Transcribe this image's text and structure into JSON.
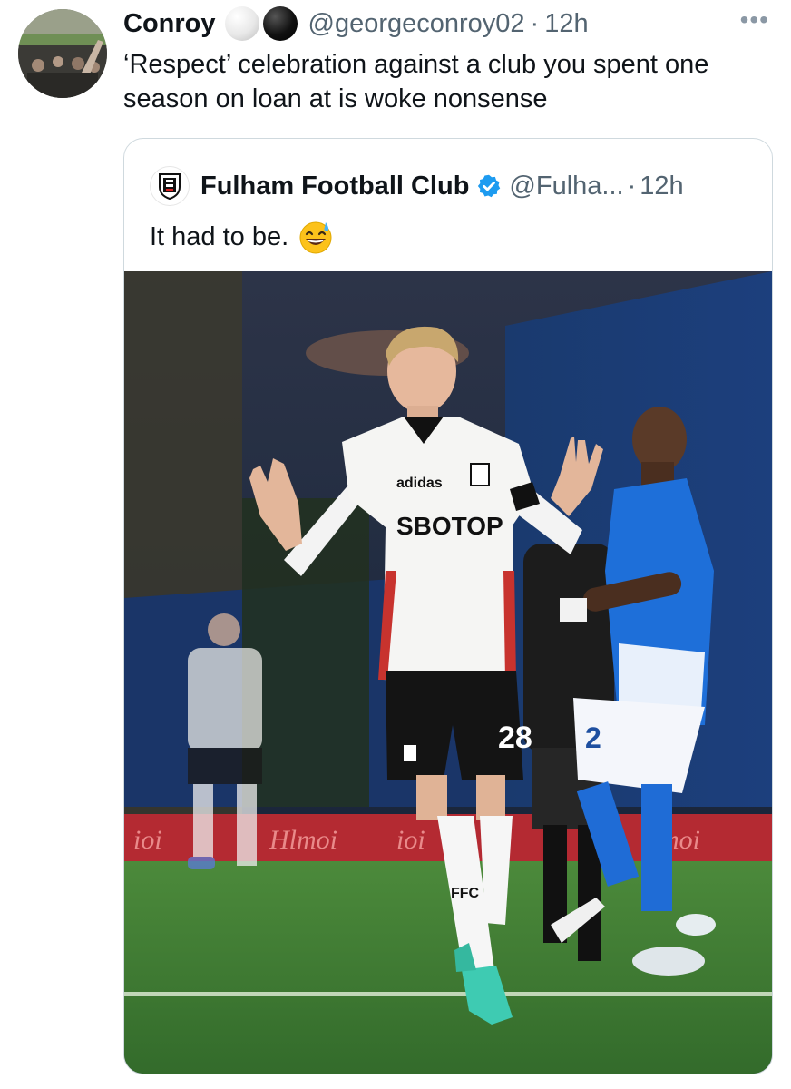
{
  "tweet": {
    "display_name": "Conroy",
    "handle": "@georgeconroy02",
    "separator": "·",
    "time": "12h",
    "more_label": "•••",
    "text": "‘Respect’ celebration against a club you spent one season on loan at is woke nonsense",
    "name_emoji": [
      "white-circle",
      "black-circle"
    ]
  },
  "quoted_tweet": {
    "display_name": "Fulham Football Club",
    "verified": true,
    "handle": "@Fulha...",
    "separator": "·",
    "time": "12h",
    "text": "It had to be.",
    "emoji": "grinning-face-with-sweat",
    "photo": {
      "shirt_sponsor": "SBOTOP",
      "player_number": "28",
      "opponent_number": "2",
      "sock_text": "FFC"
    }
  },
  "colors": {
    "verified_blue": "#1d9bf0",
    "secondary_text": "#536471",
    "border": "#cfd9de",
    "opponent_blue": "#1e6fd9",
    "pitch_green": "#3f7f35"
  }
}
